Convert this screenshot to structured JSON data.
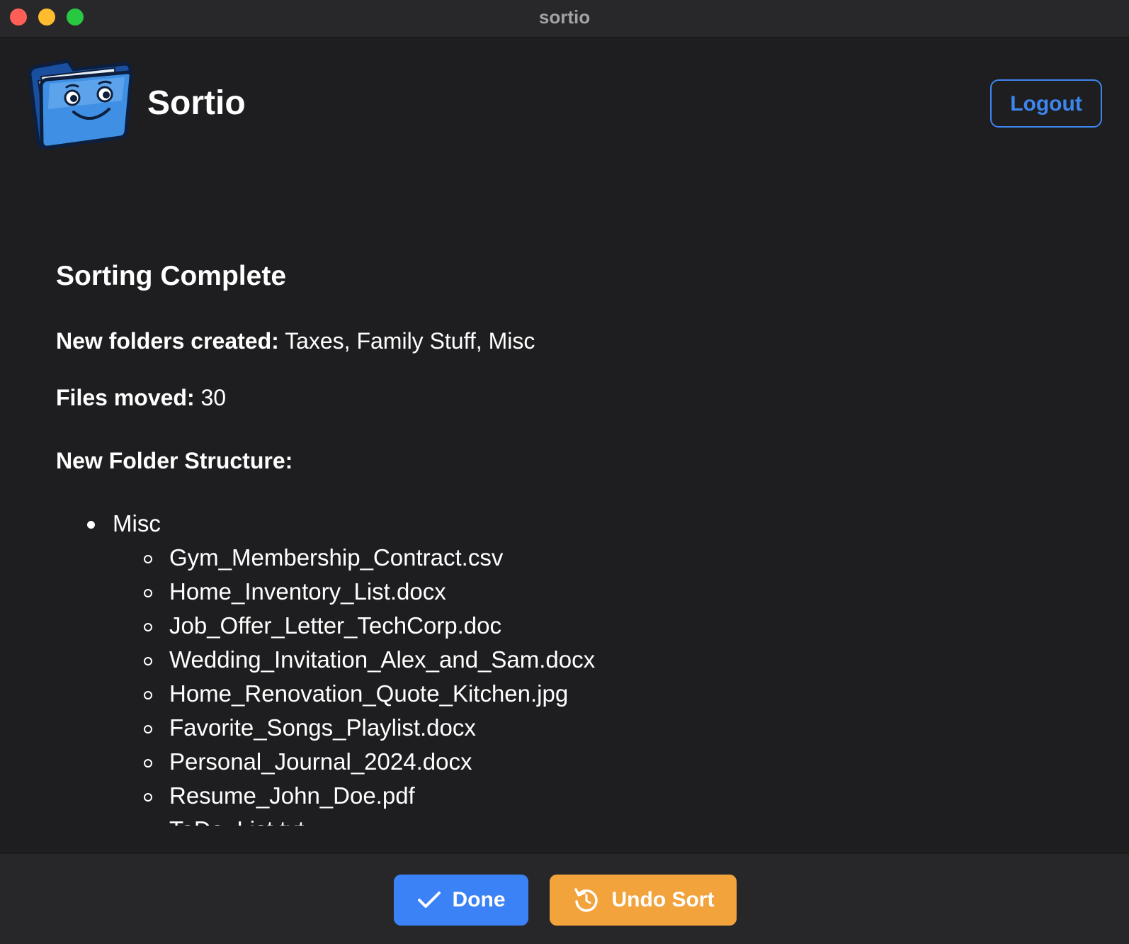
{
  "window": {
    "title": "sortio"
  },
  "header": {
    "app_name": "Sortio",
    "logout_label": "Logout"
  },
  "result": {
    "title": "Sorting Complete",
    "new_folders_label": "New folders created:",
    "new_folders_value": "Taxes, Family Stuff, Misc",
    "files_moved_label": "Files moved:",
    "files_moved_value": "30",
    "structure_heading": "New Folder Structure:",
    "folders": [
      {
        "name": "Misc",
        "files": [
          "Gym_Membership_Contract.csv",
          "Home_Inventory_List.docx",
          "Job_Offer_Letter_TechCorp.doc",
          "Wedding_Invitation_Alex_and_Sam.docx",
          "Home_Renovation_Quote_Kitchen.jpg",
          "Favorite_Songs_Playlist.docx",
          "Personal_Journal_2024.docx",
          "Resume_John_Doe.pdf",
          "ToDo_List.txt"
        ]
      }
    ]
  },
  "footer": {
    "done_label": "Done",
    "undo_label": "Undo Sort"
  },
  "colors": {
    "background": "#1e1e20",
    "accent_blue": "#3b82f6",
    "accent_orange": "#f2a33c"
  },
  "icons": {
    "logo": "folder-mascot-icon",
    "done": "checkmark-icon",
    "undo": "undo-arrow-icon"
  }
}
